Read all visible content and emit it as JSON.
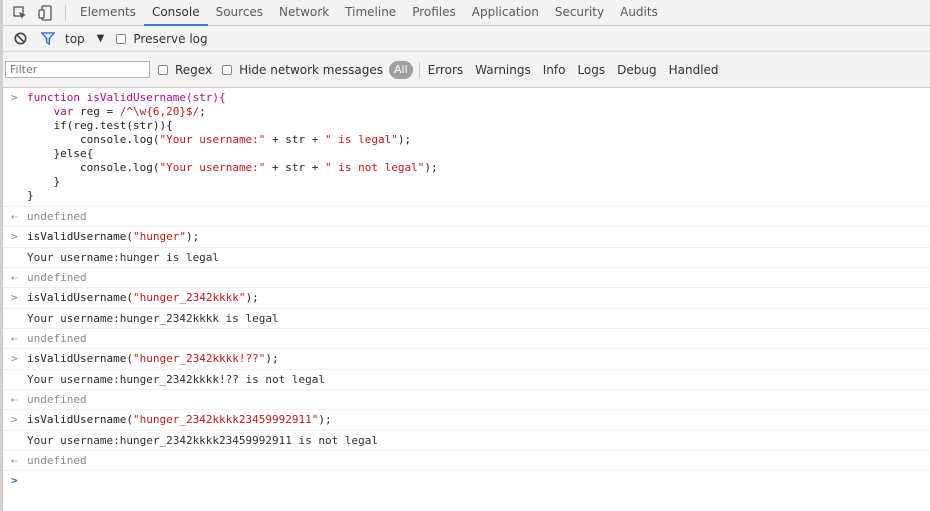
{
  "tabs": [
    "Elements",
    "Console",
    "Sources",
    "Network",
    "Timeline",
    "Profiles",
    "Application",
    "Security",
    "Audits"
  ],
  "toolbar": {
    "context": "top",
    "preserve_log": "Preserve log"
  },
  "filter": {
    "placeholder": "Filter",
    "regex": "Regex",
    "hide_network": "Hide network messages",
    "all": "All",
    "levels": [
      "Errors",
      "Warnings",
      "Info",
      "Logs",
      "Debug",
      "Handled"
    ]
  },
  "console": {
    "func": {
      "l1": "function isValidUsername(str){",
      "l2a": "var",
      "l2b": " reg = ",
      "l2c": "/^\\w{6,20}$/",
      "l2d": ";",
      "l3": "if(reg.test(str)){",
      "l4a": "console.log(",
      "l4b": "\"Your username:\"",
      "l4c": " + str + ",
      "l4d": "\" is legal\"",
      "l4e": ");",
      "l5": "}else{",
      "l6a": "console.log(",
      "l6b": "\"Your username:\"",
      "l6c": " + str + ",
      "l6d": "\" is not legal\"",
      "l6e": ");",
      "l7": "}",
      "l8": "}"
    },
    "undefined": "undefined",
    "calls": [
      {
        "pre": "isValidUsername(",
        "arg": "\"hunger\"",
        "post": ");",
        "log": "Your username:hunger is legal"
      },
      {
        "pre": "isValidUsername(",
        "arg": "\"hunger_2342kkkk\"",
        "post": ");",
        "log": "Your username:hunger_2342kkkk is legal"
      },
      {
        "pre": "isValidUsername(",
        "arg": "\"hunger_2342kkkk!??\"",
        "post": ");",
        "log": "Your username:hunger_2342kkkk!?? is not legal"
      },
      {
        "pre": "isValidUsername(",
        "arg": "\"hunger_2342kkkk23459992911\"",
        "post": ");",
        "log": "Your username:hunger_2342kkkk23459992911 is not legal"
      }
    ]
  }
}
